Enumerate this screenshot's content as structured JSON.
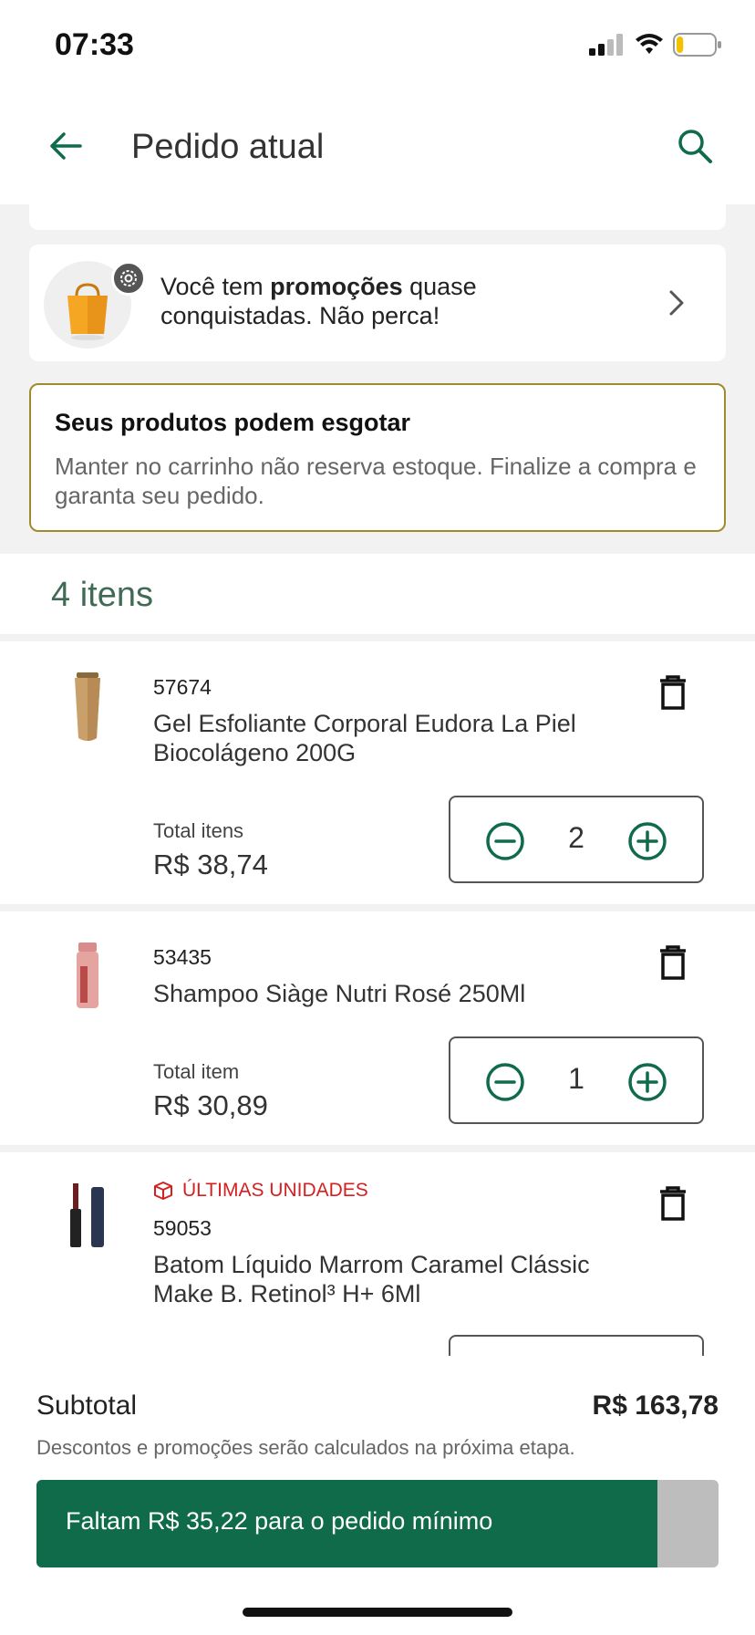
{
  "status": {
    "time": "07:33",
    "battery_level": 0.18
  },
  "appbar": {
    "title": "Pedido atual"
  },
  "promo": {
    "text_prefix": "Você tem ",
    "text_bold": "promoções",
    "text_suffix": " quase conquistadas. Não perca!"
  },
  "warning": {
    "title": "Seus produtos podem esgotar",
    "body": "Manter no carrinho não reserva estoque. Finalize a compra e garanta seu pedido."
  },
  "items_header": {
    "count_label": "4 itens"
  },
  "items": [
    {
      "code": "57674",
      "name": "Gel Esfoliante Corporal Eudora La Piel Biocolágeno 200G",
      "total_label": "Total itens",
      "total_value": "R$ 38,74",
      "quantity": "2"
    },
    {
      "code": "53435",
      "name": "Shampoo Siàge Nutri Rosé 250Ml",
      "total_label": "Total item",
      "total_value": "R$ 30,89",
      "quantity": "1"
    },
    {
      "low_stock_label": "ÚLTIMAS UNIDADES",
      "code": "59053",
      "name": "Batom Líquido Marrom Caramel Clássic Make B. Retinol³ H+ 6Ml"
    }
  ],
  "summary": {
    "subtotal_label": "Subtotal",
    "subtotal_value": "R$ 163,78",
    "discount_note": "Descontos e promoções serão calculados na próxima etapa.",
    "min_order_text": "Faltam R$ 35,22 para o pedido mínimo",
    "min_order_progress": 0.91
  },
  "colors": {
    "primary": "#0f6b4a",
    "accent_green_text": "#3f6b55",
    "warning_border": "#a08a2c",
    "low_stock_red": "#d42020"
  }
}
